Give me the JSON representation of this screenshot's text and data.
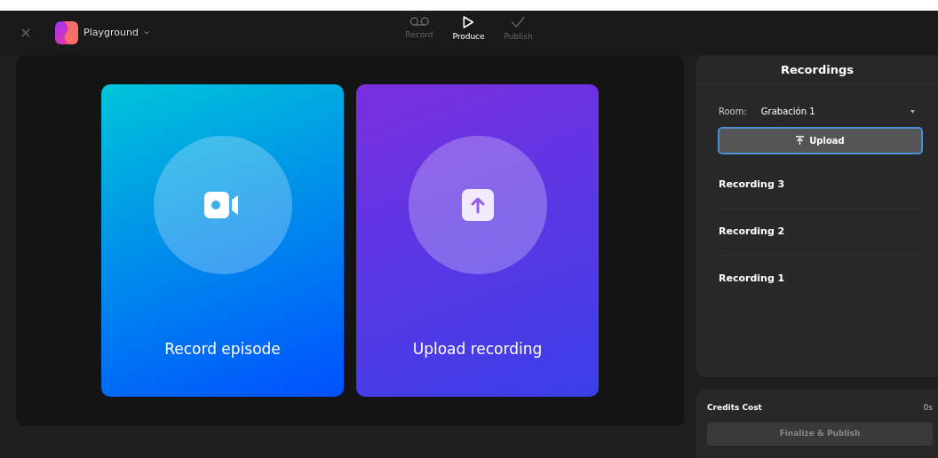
{
  "header": {
    "project": "Playground",
    "steps": [
      {
        "label": "Record",
        "selected": false
      },
      {
        "label": "Produce",
        "selected": true
      },
      {
        "label": "Publish",
        "selected": false
      }
    ]
  },
  "actions": [
    {
      "label": "Record episode",
      "kind": "record"
    },
    {
      "label": "Upload recording",
      "kind": "upload"
    }
  ],
  "recordings": {
    "title": "Recordings",
    "room_label": "Room:",
    "room_value": "Grabación 1",
    "upload_button": "Upload",
    "items": [
      "Recording 3",
      "Recording 2",
      "Recording 1"
    ]
  },
  "credits": {
    "label": "Credits Cost",
    "value": "0s",
    "button": "Finalize & Publish",
    "button_disabled": true
  }
}
